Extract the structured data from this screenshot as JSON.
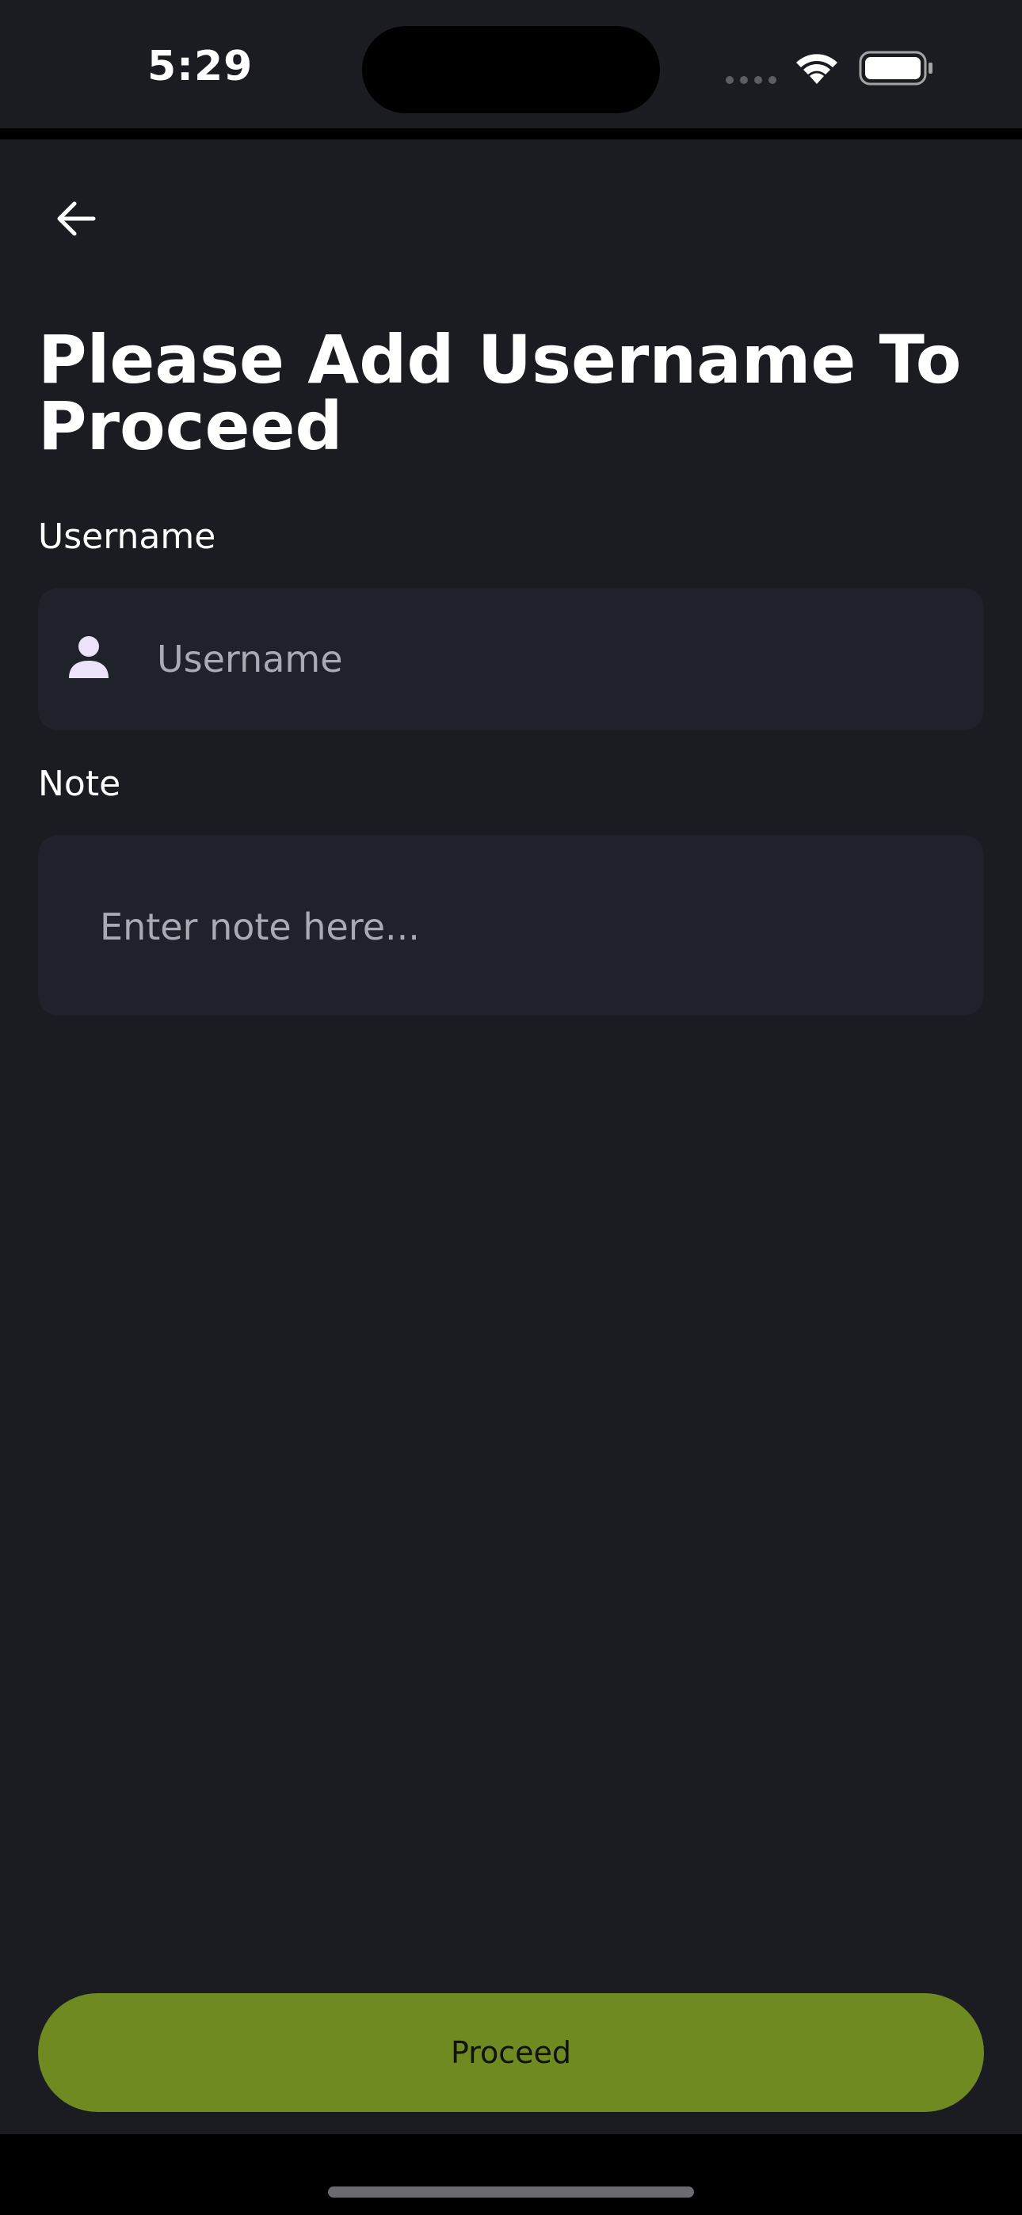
{
  "status_bar": {
    "time": "5:29",
    "icons": [
      "signal-dots-icon",
      "wifi-icon",
      "battery-icon"
    ]
  },
  "header": {
    "back_icon": "arrow-left-icon"
  },
  "title": "Please Add Username To Proceed",
  "form": {
    "username": {
      "label": "Username",
      "icon": "user-icon",
      "value": "",
      "placeholder": "Username"
    },
    "note": {
      "label": "Note",
      "value": "",
      "placeholder": "Enter note here..."
    }
  },
  "actions": {
    "proceed_label": "Proceed"
  },
  "colors": {
    "background": "#1b1c21",
    "input_background": "#20222b",
    "accent": "#6e8a21",
    "placeholder": "#a9aab3",
    "icon_tint": "#ece3fb"
  }
}
